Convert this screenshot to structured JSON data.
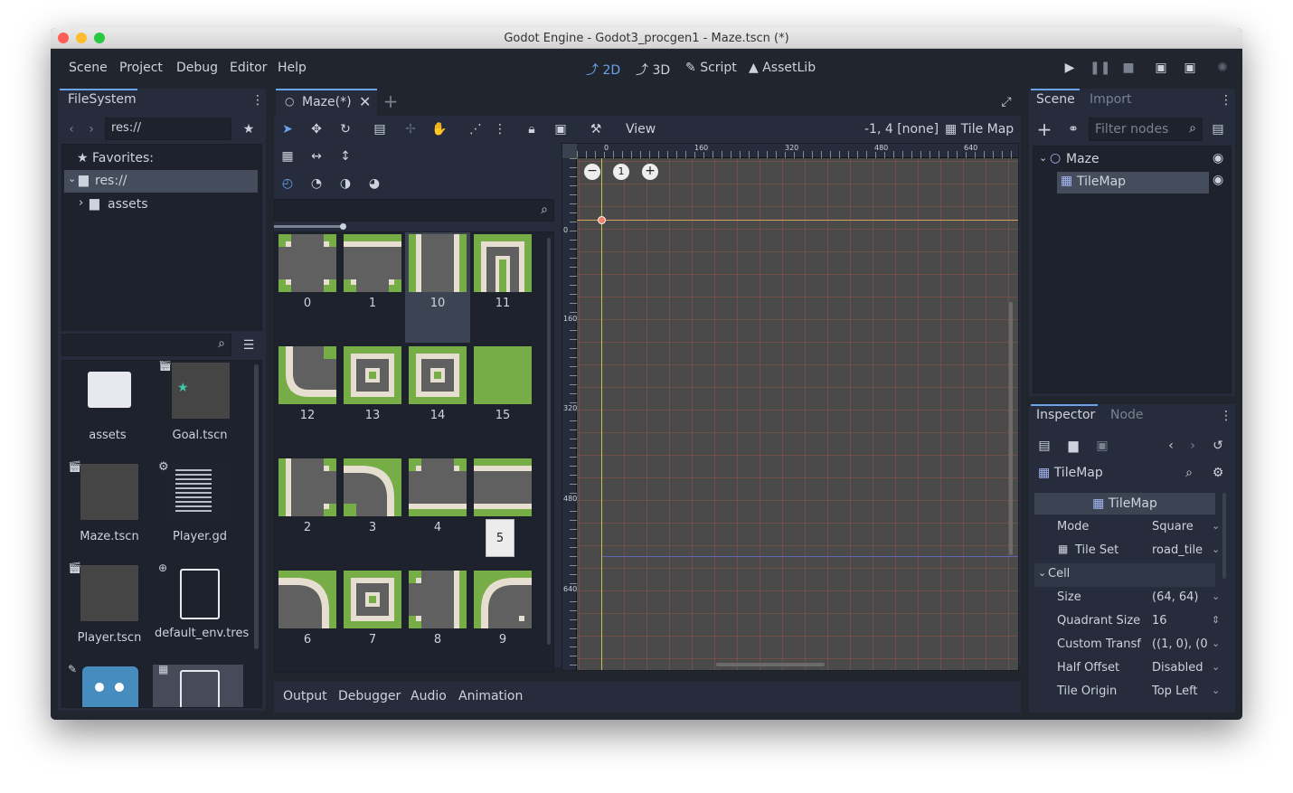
{
  "window": {
    "title": "Godot Engine - Godot3_procgen1 - Maze.tscn (*)"
  },
  "menu": [
    "Scene",
    "Project",
    "Debug",
    "Editor",
    "Help"
  ],
  "workspaces": [
    {
      "label": "2D",
      "icon": "2d-icon"
    },
    {
      "label": "3D",
      "icon": "3d-icon"
    },
    {
      "label": "Script",
      "icon": "script-icon"
    },
    {
      "label": "AssetLib",
      "icon": "assetlib-icon"
    }
  ],
  "filesystem": {
    "tab": "FileSystem",
    "path": "res://",
    "tree": {
      "favorites": "Favorites:",
      "root": "res://",
      "child": "assets"
    },
    "search_placeholder": "",
    "items": [
      {
        "label": "assets",
        "icon": "folder-icon"
      },
      {
        "label": "Goal.tscn",
        "icon": "scene-icon"
      },
      {
        "label": "Maze.tscn",
        "icon": "scene-icon"
      },
      {
        "label": "Player.gd",
        "icon": "script-icon"
      },
      {
        "label": "Player.tscn",
        "icon": "scene-icon"
      },
      {
        "label": "default_env.tres",
        "icon": "resource-icon"
      }
    ]
  },
  "editor": {
    "tab": "Maze(*)",
    "view_menu": "View",
    "cursor_status": "-1, 4 [none]",
    "tilemap_label": "Tile Map",
    "ruler_top": [
      "0",
      "160",
      "320",
      "480",
      "640"
    ],
    "ruler_left": [
      "0",
      "160",
      "320",
      "480",
      "640"
    ],
    "tiles": [
      "0",
      "1",
      "10",
      "11",
      "12",
      "13",
      "14",
      "15",
      "2",
      "3",
      "4",
      "5",
      "6",
      "7",
      "8",
      "9"
    ],
    "tooltip": "5"
  },
  "bottom_tabs": [
    "Output",
    "Debugger",
    "Audio",
    "Animation"
  ],
  "scene_panel": {
    "tabs": [
      "Scene",
      "Import"
    ],
    "filter_placeholder": "Filter nodes",
    "nodes": [
      {
        "label": "Maze",
        "icon": "node2d-icon"
      },
      {
        "label": "TileMap",
        "icon": "tilemap-icon"
      }
    ]
  },
  "inspector": {
    "tabs": [
      "Inspector",
      "Node"
    ],
    "object": "TileMap",
    "section": "TileMap",
    "properties": [
      {
        "name": "Mode",
        "value": "Square"
      },
      {
        "name": "Tile Set",
        "value": "road_tile"
      }
    ],
    "group": "Cell",
    "cell_properties": [
      {
        "name": "Size",
        "value": "(64, 64)"
      },
      {
        "name": "Quadrant Size",
        "value": "16"
      },
      {
        "name": "Custom Transf",
        "value": "((1, 0), (0"
      },
      {
        "name": "Half Offset",
        "value": "Disabled"
      },
      {
        "name": "Tile Origin",
        "value": "Top Left"
      }
    ]
  },
  "colors": {
    "accent": "#6aa3ea",
    "grass": "#77ad46",
    "road": "#606060",
    "kerb": "#e6dfd1",
    "panel": "#262c3b",
    "bg": "#20252e"
  }
}
